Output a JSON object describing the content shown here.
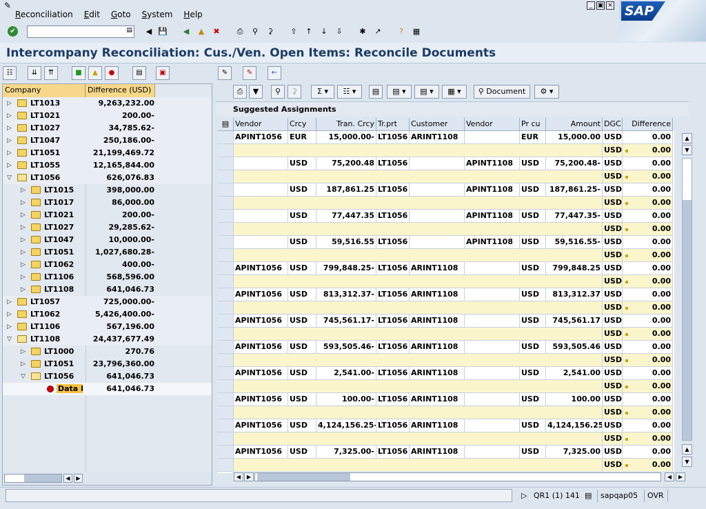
{
  "menu": {
    "items": [
      "Reconciliation",
      "Edit",
      "Goto",
      "System",
      "Help"
    ]
  },
  "brand": {
    "logo_text": "SAP"
  },
  "toolbar": {
    "command_value": ""
  },
  "title": "Intercompany Reconciliation: Cus./Ven. Open Items: Reconcile Documents",
  "tree": {
    "columns": [
      "Company",
      "Difference (USD)"
    ],
    "rows": [
      {
        "level": 0,
        "state": "closed",
        "label": "LT1013",
        "value": "9,263,232.00"
      },
      {
        "level": 0,
        "state": "closed",
        "label": "LT1021",
        "value": "200.00-"
      },
      {
        "level": 0,
        "state": "closed",
        "label": "LT1027",
        "value": "34,785.62-"
      },
      {
        "level": 0,
        "state": "closed",
        "label": "LT1047",
        "value": "250,186.00-"
      },
      {
        "level": 0,
        "state": "closed",
        "label": "LT1051",
        "value": "21,199,469.72"
      },
      {
        "level": 0,
        "state": "closed",
        "label": "LT1055",
        "value": "12,165,844.00"
      },
      {
        "level": 0,
        "state": "open",
        "label": "LT1056",
        "value": "626,076.83"
      },
      {
        "level": 1,
        "state": "closed",
        "label": "LT1015",
        "value": "398,000.00"
      },
      {
        "level": 1,
        "state": "closed",
        "label": "LT1017",
        "value": "86,000.00"
      },
      {
        "level": 1,
        "state": "closed",
        "label": "LT1021",
        "value": "200.00-"
      },
      {
        "level": 1,
        "state": "closed",
        "label": "LT1027",
        "value": "29,285.62-"
      },
      {
        "level": 1,
        "state": "closed",
        "label": "LT1047",
        "value": "10,000.00-"
      },
      {
        "level": 1,
        "state": "closed",
        "label": "LT1051",
        "value": "1,027,680.28-"
      },
      {
        "level": 1,
        "state": "closed",
        "label": "LT1062",
        "value": "400.00-"
      },
      {
        "level": 1,
        "state": "closed",
        "label": "LT1106",
        "value": "568,596.00"
      },
      {
        "level": 1,
        "state": "closed",
        "label": "LT1108",
        "value": "641,046.73"
      },
      {
        "level": 0,
        "state": "closed",
        "label": "LT1057",
        "value": "725,000.00-"
      },
      {
        "level": 0,
        "state": "closed",
        "label": "LT1062",
        "value": "5,426,400.00-"
      },
      {
        "level": 0,
        "state": "closed",
        "label": "LT1106",
        "value": "567,196.00"
      },
      {
        "level": 0,
        "state": "open",
        "label": "LT1108",
        "value": "24,437,677.49"
      },
      {
        "level": 1,
        "state": "closed",
        "label": "LT1000",
        "value": "270.76"
      },
      {
        "level": 1,
        "state": "closed",
        "label": "LT1051",
        "value": "23,796,360.00"
      },
      {
        "level": 1,
        "state": "open",
        "label": "LT1056",
        "value": "641,046.73"
      },
      {
        "level": 2,
        "state": "leaf",
        "label": "Data R",
        "value": "641,046.73"
      }
    ]
  },
  "right_toolbar": {
    "document_label": "Document"
  },
  "section_title": "Suggested Assignments",
  "grid": {
    "columns": [
      "Vendor",
      "Crcy",
      "Tran. Crcy",
      "Tr.prt",
      "Customer",
      "Vendor",
      "Pr cu",
      "Amount",
      "DGC",
      "Difference"
    ],
    "rows": [
      {
        "vendor": "APINT1056",
        "crcy": "EUR",
        "tran": "15,000.00-",
        "trprt": "LT1056",
        "customer": "ARINT1108",
        "vendor2": "",
        "prcu": "EUR",
        "amount": "15,000.00",
        "dgc": "USD",
        "diff": "0.00"
      },
      {
        "vendor": "",
        "crcy": "USD",
        "tran": "75,200.48",
        "trprt": "LT1056",
        "customer": "",
        "vendor2": "APINT1108",
        "prcu": "USD",
        "amount": "75,200.48-",
        "dgc": "USD",
        "diff": "0.00"
      },
      {
        "vendor": "",
        "crcy": "USD",
        "tran": "187,861.25",
        "trprt": "LT1056",
        "customer": "",
        "vendor2": "APINT1108",
        "prcu": "USD",
        "amount": "187,861.25-",
        "dgc": "USD",
        "diff": "0.00"
      },
      {
        "vendor": "",
        "crcy": "USD",
        "tran": "77,447.35",
        "trprt": "LT1056",
        "customer": "",
        "vendor2": "APINT1108",
        "prcu": "USD",
        "amount": "77,447.35-",
        "dgc": "USD",
        "diff": "0.00"
      },
      {
        "vendor": "",
        "crcy": "USD",
        "tran": "59,516.55",
        "trprt": "LT1056",
        "customer": "",
        "vendor2": "APINT1108",
        "prcu": "USD",
        "amount": "59,516.55-",
        "dgc": "USD",
        "diff": "0.00"
      },
      {
        "vendor": "APINT1056",
        "crcy": "USD",
        "tran": "799,848.25-",
        "trprt": "LT1056",
        "customer": "ARINT1108",
        "vendor2": "",
        "prcu": "USD",
        "amount": "799,848.25",
        "dgc": "USD",
        "diff": "0.00"
      },
      {
        "vendor": "APINT1056",
        "crcy": "USD",
        "tran": "813,312.37-",
        "trprt": "LT1056",
        "customer": "ARINT1108",
        "vendor2": "",
        "prcu": "USD",
        "amount": "813,312.37",
        "dgc": "USD",
        "diff": "0.00"
      },
      {
        "vendor": "APINT1056",
        "crcy": "USD",
        "tran": "745,561.17-",
        "trprt": "LT1056",
        "customer": "ARINT1108",
        "vendor2": "",
        "prcu": "USD",
        "amount": "745,561.17",
        "dgc": "USD",
        "diff": "0.00"
      },
      {
        "vendor": "APINT1056",
        "crcy": "USD",
        "tran": "593,505.46-",
        "trprt": "LT1056",
        "customer": "ARINT1108",
        "vendor2": "",
        "prcu": "USD",
        "amount": "593,505.46",
        "dgc": "USD",
        "diff": "0.00"
      },
      {
        "vendor": "APINT1056",
        "crcy": "USD",
        "tran": "2,541.00-",
        "trprt": "LT1056",
        "customer": "ARINT1108",
        "vendor2": "",
        "prcu": "USD",
        "amount": "2,541.00",
        "dgc": "USD",
        "diff": "0.00"
      },
      {
        "vendor": "APINT1056",
        "crcy": "USD",
        "tran": "100.00-",
        "trprt": "LT1056",
        "customer": "ARINT1108",
        "vendor2": "",
        "prcu": "USD",
        "amount": "100.00",
        "dgc": "USD",
        "diff": "0.00"
      },
      {
        "vendor": "APINT1056",
        "crcy": "USD",
        "tran": "4,124,156.25-",
        "trprt": "LT1056",
        "customer": "ARINT1108",
        "vendor2": "",
        "prcu": "USD",
        "amount": "4,124,156.25",
        "dgc": "USD",
        "diff": "0.00"
      },
      {
        "vendor": "APINT1056",
        "crcy": "USD",
        "tran": "7,325.00-",
        "trprt": "LT1056",
        "customer": "ARINT1108",
        "vendor2": "",
        "prcu": "USD",
        "amount": "7,325.00",
        "dgc": "USD",
        "diff": "0.00"
      }
    ],
    "sub_dgc": "USD",
    "sub_diff": "0.00"
  },
  "status": {
    "system": "QR1 (1) 141",
    "server": "sapqap05",
    "mode": "OVR"
  },
  "colors": {
    "header_gold": "#f7d88a",
    "subtotal_yellow": "#fbf5cc",
    "title_blue": "#1c3c66"
  }
}
